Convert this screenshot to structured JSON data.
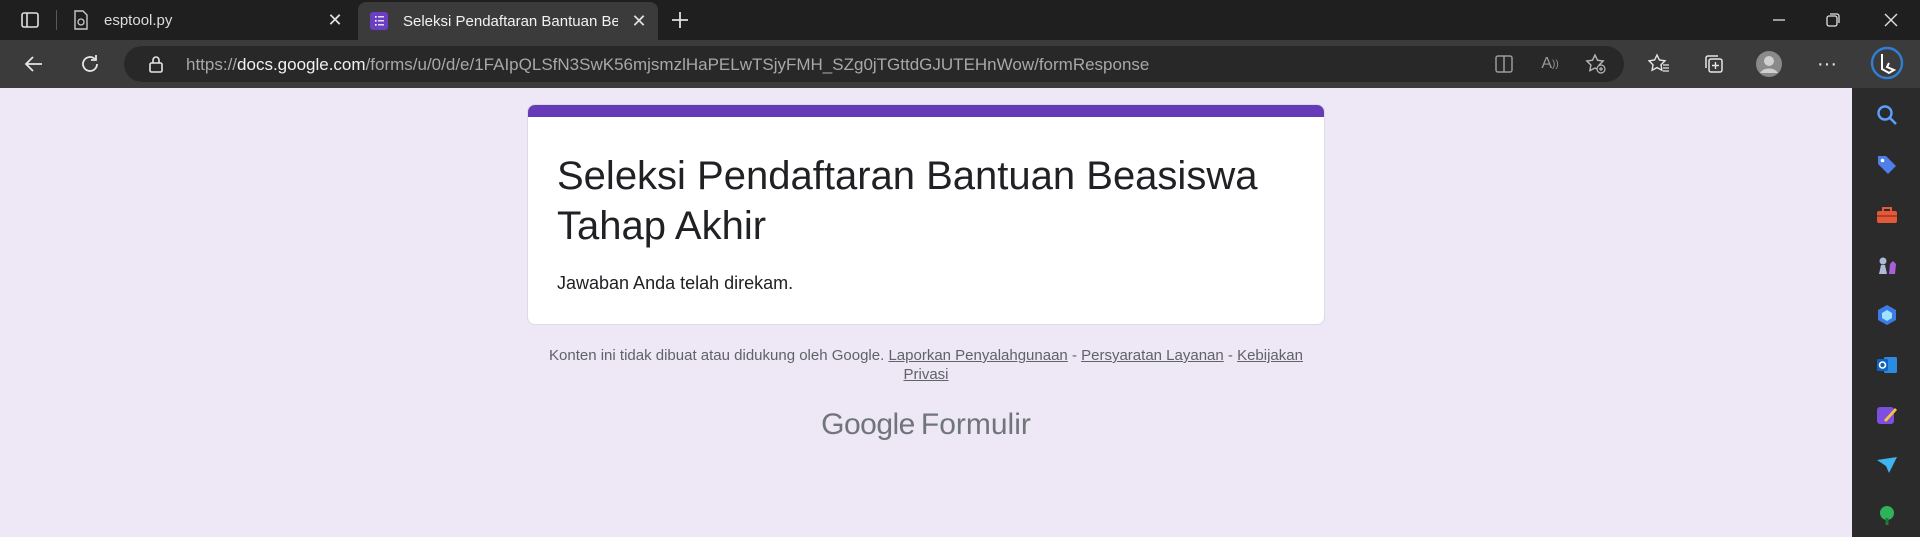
{
  "browser": {
    "tabs": [
      {
        "title": "esptool.py",
        "active": false
      },
      {
        "title": "Seleksi Pendaftaran Bantuan Bea",
        "active": true
      }
    ],
    "url": {
      "scheme": "https://",
      "host": "docs.google.com",
      "path": "/forms/u/0/d/e/1FAIpQLSfN3SwK56mjsmzlHaPELwTSjyFMH_SZg0jTGttdGJUTEHnWow/formResponse"
    }
  },
  "form": {
    "title": "Seleksi Pendaftaran Bantuan Beasiswa Tahap Akhir",
    "message": "Jawaban Anda telah direkam.",
    "accent_color": "#673ab7",
    "background_color": "#ede7f6"
  },
  "footer": {
    "disclaimer": "Konten ini tidak dibuat atau didukung oleh Google.",
    "link_abuse": "Laporkan Penyalahgunaan",
    "sep1": " - ",
    "link_terms": "Persyaratan Layanan",
    "sep2": " - ",
    "link_privacy": "Kebijakan Privasi",
    "brand_google": "Google",
    "brand_product": "Formulir"
  },
  "sidebar_icons": [
    "search-icon",
    "tag-icon",
    "toolbox-icon",
    "chess-icon",
    "copilot-icon",
    "outlook-icon",
    "designer-icon",
    "send-icon",
    "tree-icon"
  ]
}
